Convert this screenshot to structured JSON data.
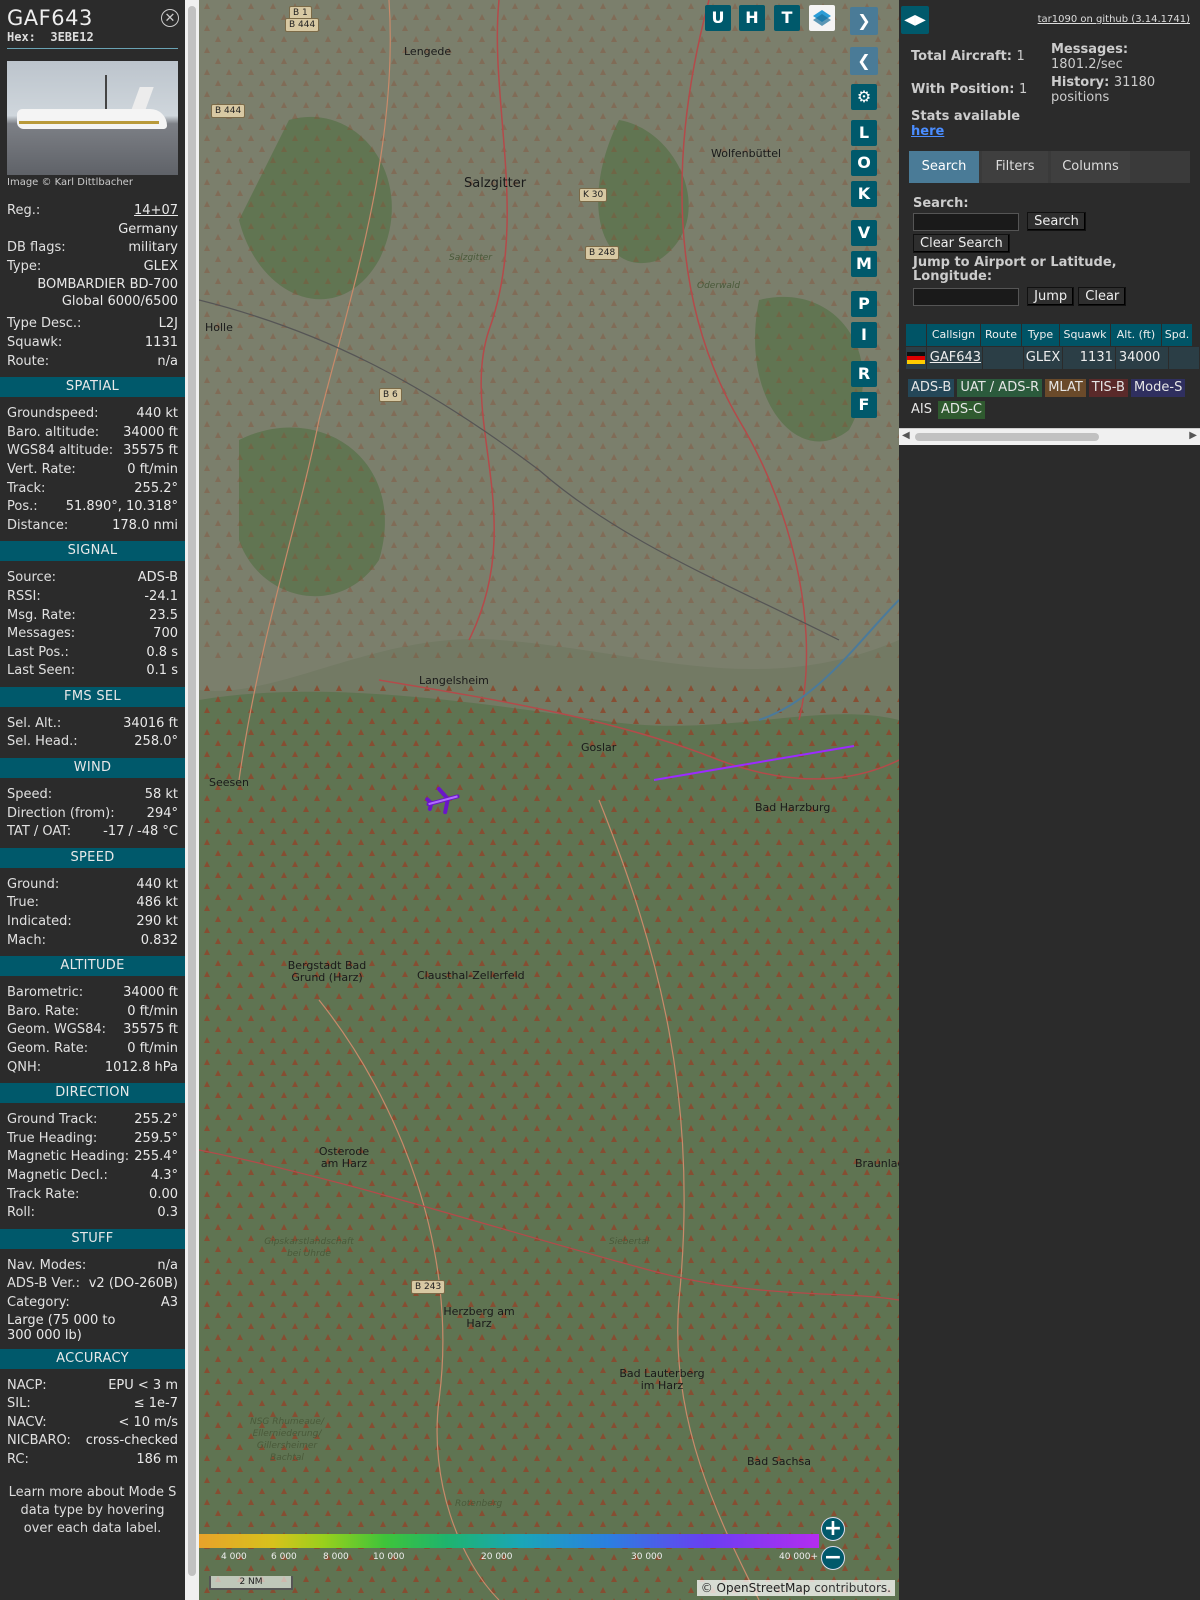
{
  "info": {
    "callsign": "GAF643",
    "hex_label": "Hex:",
    "hex": "3EBE12",
    "photo_credit": "Image © Karl Dittlbacher",
    "rows_top": [
      {
        "k": "Reg.:",
        "v": "14+07",
        "link": true
      },
      {
        "k": "",
        "v": "Germany"
      },
      {
        "k": "DB flags:",
        "v": "military"
      },
      {
        "k": "Type:",
        "v": "GLEX"
      }
    ],
    "type_full_1": "BOMBARDIER BD-700",
    "type_full_2": "Global 6000/6500",
    "rows_type": [
      {
        "k": "Type Desc.:",
        "v": "L2J"
      },
      {
        "k": "Squawk:",
        "v": "1131"
      },
      {
        "k": "Route:",
        "v": "n/a"
      }
    ],
    "sections": [
      {
        "title": "SPATIAL",
        "rows": [
          {
            "k": "Groundspeed:",
            "v": "440 kt"
          },
          {
            "k": "Baro. altitude:",
            "v": "34000 ft"
          },
          {
            "k": "WGS84 altitude:",
            "v": "35575 ft"
          },
          {
            "k": "Vert. Rate:",
            "v": "0 ft/min"
          },
          {
            "k": "Track:",
            "v": "255.2°"
          },
          {
            "k": "Pos.:",
            "v": "51.890°, 10.318°"
          },
          {
            "k": "Distance:",
            "v": "178.0 nmi"
          }
        ]
      },
      {
        "title": "SIGNAL",
        "rows": [
          {
            "k": "Source:",
            "v": "ADS-B"
          },
          {
            "k": "RSSI:",
            "v": "-24.1"
          },
          {
            "k": "Msg. Rate:",
            "v": "23.5"
          },
          {
            "k": "Messages:",
            "v": "700"
          },
          {
            "k": "Last Pos.:",
            "v": "0.8 s"
          },
          {
            "k": "Last Seen:",
            "v": "0.1 s"
          }
        ]
      },
      {
        "title": "FMS SEL",
        "rows": [
          {
            "k": "Sel. Alt.:",
            "v": "34016 ft"
          },
          {
            "k": "Sel. Head.:",
            "v": "258.0°"
          }
        ]
      },
      {
        "title": "WIND",
        "rows": [
          {
            "k": "Speed:",
            "v": "58 kt"
          },
          {
            "k": "Direction (from):",
            "v": "294°"
          },
          {
            "k": "TAT / OAT:",
            "v": "-17 / -48 °C"
          }
        ]
      },
      {
        "title": "SPEED",
        "rows": [
          {
            "k": "Ground:",
            "v": "440 kt"
          },
          {
            "k": "True:",
            "v": "486 kt"
          },
          {
            "k": "Indicated:",
            "v": "290 kt"
          },
          {
            "k": "Mach:",
            "v": "0.832"
          }
        ]
      },
      {
        "title": "ALTITUDE",
        "rows": [
          {
            "k": "Barometric:",
            "v": "34000 ft"
          },
          {
            "k": "Baro. Rate:",
            "v": "0 ft/min"
          },
          {
            "k": "Geom. WGS84:",
            "v": "35575 ft"
          },
          {
            "k": "Geom. Rate:",
            "v": "0 ft/min"
          },
          {
            "k": "QNH:",
            "v": "1012.8 hPa"
          }
        ]
      },
      {
        "title": "DIRECTION",
        "rows": [
          {
            "k": "Ground Track:",
            "v": "255.2°"
          },
          {
            "k": "True Heading:",
            "v": "259.5°"
          },
          {
            "k": "Magnetic Heading:",
            "v": "255.4°"
          },
          {
            "k": "Magnetic Decl.:",
            "v": "4.3°"
          },
          {
            "k": "Track Rate:",
            "v": "0.00"
          },
          {
            "k": "Roll:",
            "v": "0.3"
          }
        ]
      },
      {
        "title": "STUFF",
        "rows": [
          {
            "k": "Nav. Modes:",
            "v": "n/a"
          },
          {
            "k": "ADS-B Ver.:",
            "v": "v2 (DO-260B)"
          },
          {
            "k": "Category:",
            "v": "A3"
          }
        ]
      },
      {
        "title": "ACCURACY",
        "rows": [
          {
            "k": "NACP:",
            "v": "EPU < 3 m"
          },
          {
            "k": "SIL:",
            "v": "≤ 1e-7"
          },
          {
            "k": "NACV:",
            "v": "< 10 m/s"
          },
          {
            "k": "NICBARO:",
            "v": "cross-checked"
          },
          {
            "k": "RC:",
            "v": "186 m"
          }
        ]
      }
    ],
    "category_desc_1": "Large (75 000 to",
    "category_desc_2": "300 000 lb)",
    "learn_more": "Learn more about Mode S data type by hovering over each data label."
  },
  "map": {
    "top_buttons": [
      "U",
      "H",
      "T"
    ],
    "side_buttons": [
      "L",
      "O",
      "K",
      "V",
      "M",
      "P",
      "I",
      "R",
      "F"
    ],
    "places": [
      {
        "name": "Lengede",
        "cls": ""
      },
      {
        "name": "Salzgitter",
        "cls": "big"
      },
      {
        "name": "Wolfenbüttel",
        "cls": ""
      },
      {
        "name": "Holle",
        "cls": ""
      },
      {
        "name": "Langelsheim",
        "cls": ""
      },
      {
        "name": "Goslar",
        "cls": ""
      },
      {
        "name": "Seesen",
        "cls": ""
      },
      {
        "name": "Bad Harzburg",
        "cls": ""
      },
      {
        "name": "Bergstadt Bad Grund (Harz)",
        "cls": ""
      },
      {
        "name": "Clausthal-Zellerfeld",
        "cls": ""
      },
      {
        "name": "Osterode am Harz",
        "cls": ""
      },
      {
        "name": "Braunlage",
        "cls": ""
      },
      {
        "name": "Herzberg am Harz",
        "cls": ""
      },
      {
        "name": "Bad Lauterberg im Harz",
        "cls": ""
      },
      {
        "name": "Bad Sachsa",
        "cls": ""
      }
    ],
    "minor_places": [
      "Salzgitter",
      "Oderwald",
      "Gipskarstlandschaft bei Uhrde",
      "Siebertal",
      "NSG Rhumeaue/ Ellerniederung/ Gillersheimer Bachtal",
      "Rotenberg"
    ],
    "roads": [
      "B 1",
      "B 444",
      "B 444",
      "K 30",
      "B 248",
      "B 6",
      "B 243"
    ],
    "altitude_scale": [
      "4 000",
      "6 000",
      "8 000",
      "10 000",
      "20 000",
      "30 000",
      "40 000+"
    ],
    "scale_bar": "2 NM",
    "attribution_prefix": "© ",
    "attribution_link": "OpenStreetMap",
    "attribution_suffix": " contributors.",
    "zoom_in": "+",
    "zoom_out": "−"
  },
  "panel": {
    "version_link": "tar1090 on github (3.14.1741)",
    "total_aircraft_label": "Total Aircraft:",
    "total_aircraft": "1",
    "with_position_label": "With Position:",
    "with_position": "1",
    "messages_label": "Messages:",
    "messages_rate": "1801.2/sec",
    "history_label": "History:",
    "history_value": "31180",
    "history_unit": "positions",
    "stats_label": "Stats available",
    "stats_link": "here",
    "tabs": [
      "Search",
      "Filters",
      "Columns"
    ],
    "search_label": "Search:",
    "search_button": "Search",
    "clear_search_button": "Clear Search",
    "jump_label": "Jump to Airport or Latitude, Longitude:",
    "jump_button": "Jump",
    "clear_button": "Clear",
    "table_headers": [
      "",
      "Callsign",
      "Route",
      "Type",
      "Squawk",
      "Alt. (ft)",
      "Spd."
    ],
    "table_row": {
      "flag": "DE",
      "callsign": "GAF643",
      "route": "",
      "type": "GLEX",
      "squawk": "1131",
      "alt": "34000",
      "spd": ""
    },
    "badges": [
      {
        "label": "ADS-B",
        "color": "#244758"
      },
      {
        "label": "UAT / ADS-R",
        "color": "#2b5a3c"
      },
      {
        "label": "MLAT",
        "color": "#6a4a2a"
      },
      {
        "label": "TIS-B",
        "color": "#5a2a2a"
      },
      {
        "label": "Mode-S",
        "color": "#2f2f5f"
      },
      {
        "label": "AIS",
        "color": "#2b2b2b"
      },
      {
        "label": "ADS-C",
        "color": "#2f5a2f"
      }
    ]
  },
  "colors": {
    "accent": "#00596b",
    "track": "#9b2bff"
  }
}
